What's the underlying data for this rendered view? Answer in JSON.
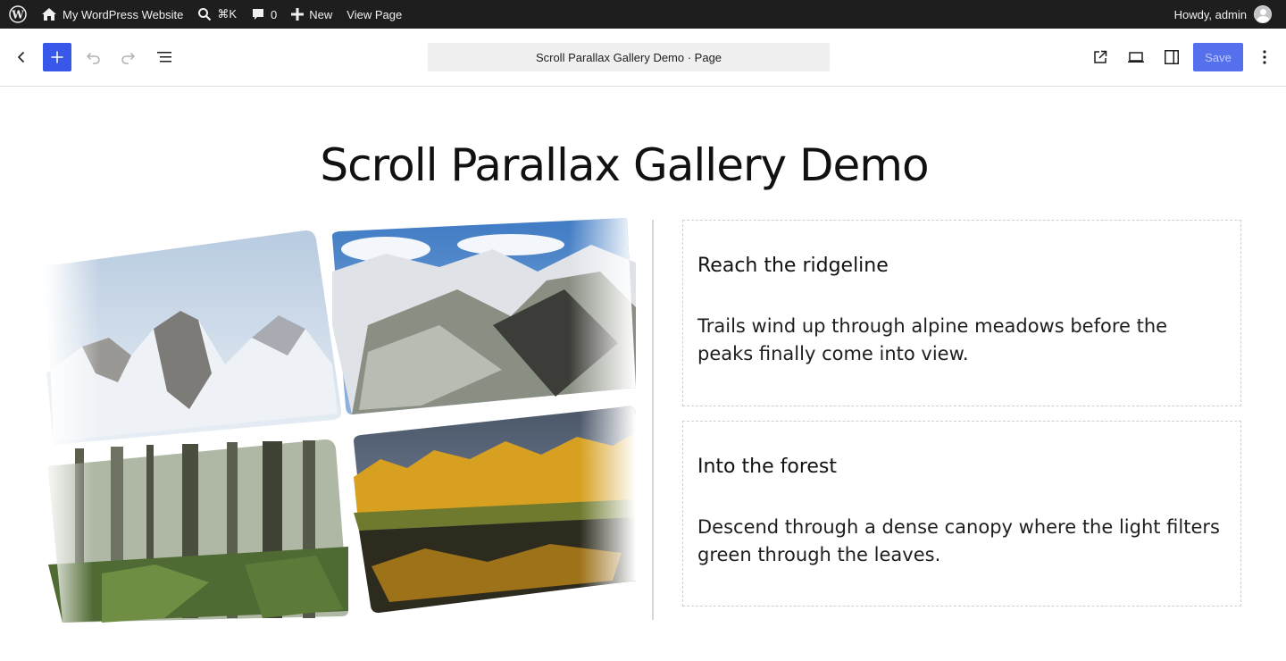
{
  "adminbar": {
    "site_name": "My WordPress Website",
    "shortcut": "⌘K",
    "comments_count": "0",
    "new_label": "New",
    "view_page_label": "View Page",
    "howdy": "Howdy, admin"
  },
  "editor": {
    "document_title": "Scroll Parallax Gallery Demo · Page",
    "save_label": "Save"
  },
  "content": {
    "page_title": "Scroll Parallax Gallery Demo",
    "cards": [
      {
        "heading": "Reach the ridgeline",
        "body": "Trails wind up through alpine meadows before the peaks finally come into view."
      },
      {
        "heading": "Into the forest",
        "body": "Descend through a dense canopy where the light filters green through the leaves."
      }
    ]
  },
  "colors": {
    "adminbar_bg": "#1e1e1e",
    "accent": "#3858e9"
  }
}
